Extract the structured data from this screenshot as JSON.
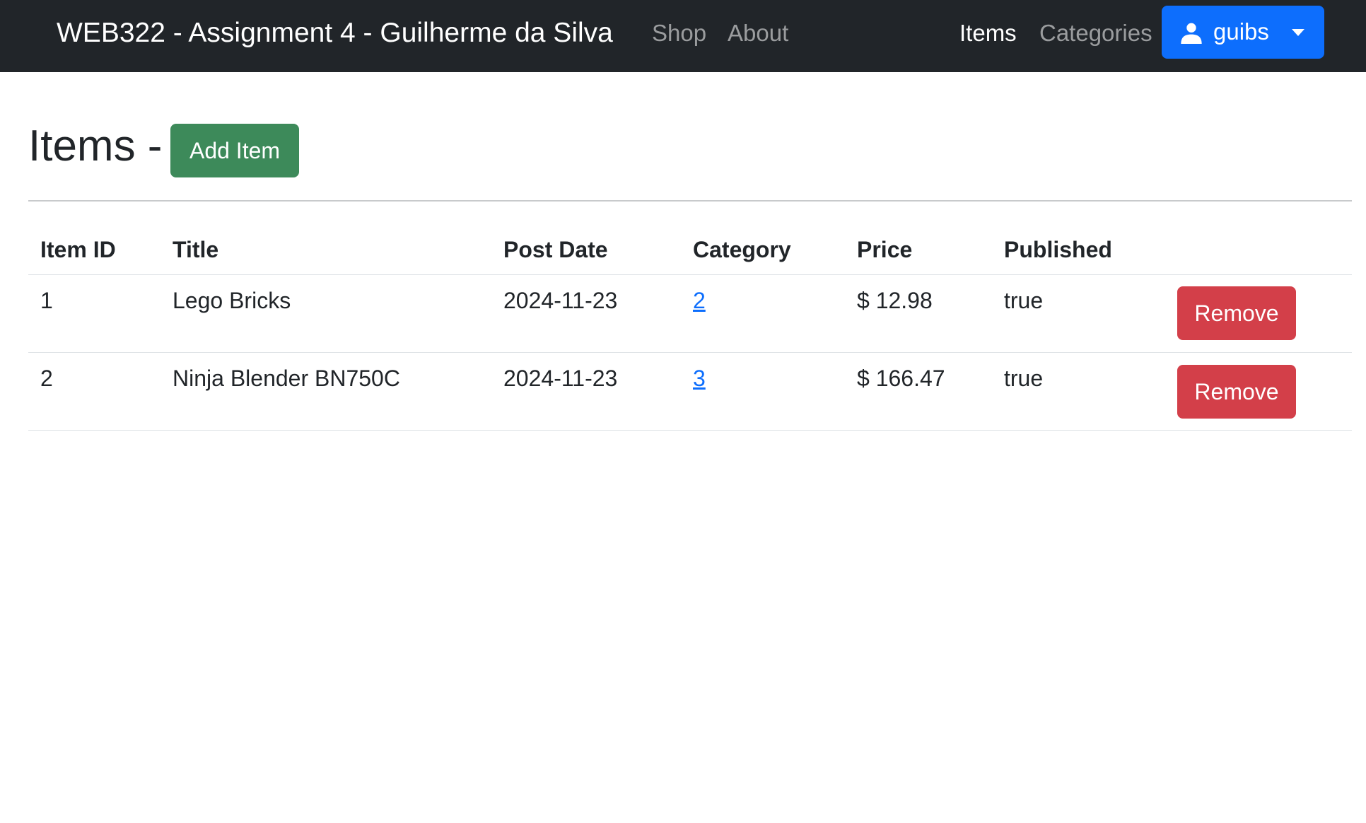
{
  "navbar": {
    "brand": "WEB322 - Assignment 4 - Guilherme da Silva",
    "left_links": [
      "Shop",
      "About"
    ],
    "right_links": [
      "Items",
      "Categories"
    ],
    "active_link": "Items",
    "user": {
      "name": "guibs",
      "icon": "person-icon"
    },
    "colors": {
      "background": "#212529",
      "user_button": "#0d6efd"
    }
  },
  "main": {
    "title": "Items -",
    "add_button_label": "Add Item",
    "colors": {
      "add_button": "#3d8a5a",
      "remove_button": "#d33f49"
    },
    "table": {
      "headers": [
        "Item ID",
        "Title",
        "Post Date",
        "Category",
        "Price",
        "Published"
      ],
      "rows": [
        {
          "id": "1",
          "title": "Lego Bricks",
          "post_date": "2024-11-23",
          "category": "2",
          "price": "$ 12.98",
          "published": "true",
          "action": "Remove"
        },
        {
          "id": "2",
          "title": "Ninja Blender BN750C",
          "post_date": "2024-11-23",
          "category": "3",
          "price": "$ 166.47",
          "published": "true",
          "action": "Remove"
        }
      ]
    }
  }
}
